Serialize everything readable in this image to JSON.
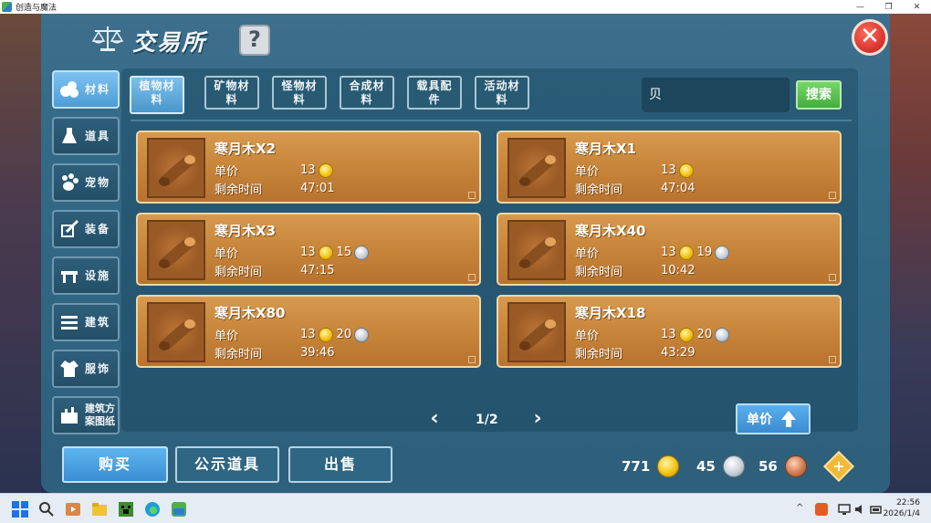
{
  "window": {
    "title": "创造与魔法",
    "controls": [
      "—",
      "❐",
      "✕"
    ]
  },
  "header": {
    "title": "交易所",
    "help": "?",
    "close": "✕"
  },
  "nav": [
    {
      "label": "材料",
      "icon": "materials-icon",
      "active": true
    },
    {
      "label": "道具",
      "icon": "potion-icon",
      "active": false
    },
    {
      "label": "宠物",
      "icon": "paw-icon",
      "active": false
    },
    {
      "label": "装备",
      "icon": "sword-icon",
      "active": false
    },
    {
      "label": "设施",
      "icon": "facility-icon",
      "active": false
    },
    {
      "label": "建筑",
      "icon": "building-icon",
      "active": false
    },
    {
      "label": "服饰",
      "icon": "clothing-icon",
      "active": false
    },
    {
      "label": "建筑方\n案图纸",
      "icon": "blueprint-icon",
      "active": false
    }
  ],
  "tabs": [
    {
      "label": "植物材\n料",
      "active": true
    },
    {
      "label": "矿物材\n料",
      "active": false
    },
    {
      "label": "怪物材\n料",
      "active": false
    },
    {
      "label": "合成材\n料",
      "active": false
    },
    {
      "label": "载具配\n件",
      "active": false
    },
    {
      "label": "活动材\n料",
      "active": false
    }
  ],
  "search": {
    "value": "贝",
    "button": "搜索"
  },
  "labels": {
    "price": "单价",
    "time_left": "剩余时间"
  },
  "items": [
    {
      "name": "寒月木X2",
      "gold": "13",
      "silver": "",
      "time": "47:01"
    },
    {
      "name": "寒月木X1",
      "gold": "13",
      "silver": "",
      "time": "47:04"
    },
    {
      "name": "寒月木X3",
      "gold": "13",
      "silver": "15",
      "time": "47:15"
    },
    {
      "name": "寒月木X40",
      "gold": "13",
      "silver": "19",
      "time": "10:42"
    },
    {
      "name": "寒月木X80",
      "gold": "13",
      "silver": "20",
      "time": "39:46"
    },
    {
      "name": "寒月木X18",
      "gold": "13",
      "silver": "20",
      "time": "43:29"
    }
  ],
  "pager": {
    "text": "1/2"
  },
  "sort": {
    "label": "单价"
  },
  "bottom": {
    "buy": "购买",
    "public": "公示道具",
    "sell": "出售"
  },
  "currency": {
    "gold": "771",
    "silver": "45",
    "bronze": "56"
  },
  "colors": {
    "card": "#c7853a",
    "panel": "#2e5f7b",
    "active_tab": "#5aa6dc",
    "search_btn": "#43ad3c"
  },
  "taskbar": {
    "time": "22:56",
    "date": "2026/1/4"
  }
}
